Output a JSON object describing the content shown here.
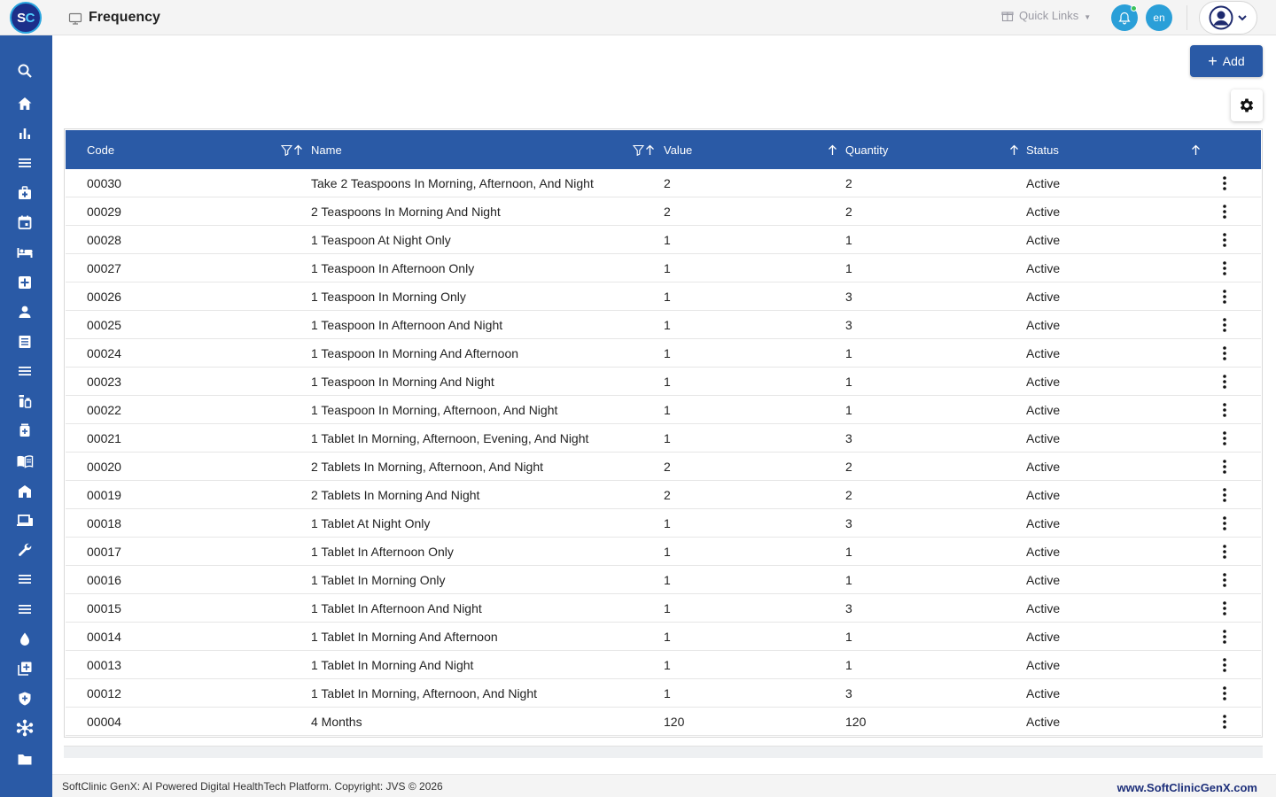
{
  "app": {
    "logo_text_s": "S",
    "logo_text_c": "C",
    "page_title": "Frequency",
    "quick_links_label": "Quick Links",
    "language": "en"
  },
  "sidebar": {
    "items": [
      {
        "icon": "search-icon"
      },
      {
        "icon": "home-icon"
      },
      {
        "icon": "bar-chart-icon"
      },
      {
        "icon": "menu-lines-icon"
      },
      {
        "icon": "medical-bag-icon"
      },
      {
        "icon": "calendar-icon"
      },
      {
        "icon": "bed-icon"
      },
      {
        "icon": "medical-cross-icon"
      },
      {
        "icon": "person-icon"
      },
      {
        "icon": "document-icon"
      },
      {
        "icon": "menu-lines-icon"
      },
      {
        "icon": "pharmacy-icon"
      },
      {
        "icon": "medicine-box-icon"
      },
      {
        "icon": "book-icon"
      },
      {
        "icon": "building-icon"
      },
      {
        "icon": "devices-icon"
      },
      {
        "icon": "wrench-icon"
      },
      {
        "icon": "menu-lines-icon"
      },
      {
        "icon": "menu-lines-icon"
      },
      {
        "icon": "drop-icon"
      },
      {
        "icon": "add-copy-icon"
      },
      {
        "icon": "shield-icon"
      },
      {
        "icon": "hub-icon"
      },
      {
        "icon": "folder-icon"
      }
    ]
  },
  "toolbar": {
    "add_label": "Add"
  },
  "table": {
    "columns": [
      "Code",
      "Name",
      "Value",
      "Quantity",
      "Status"
    ],
    "rows": [
      {
        "code": "00030",
        "name": "Take 2 Teaspoons In Morning, Afternoon, And Night",
        "value": "2",
        "quantity": "2",
        "status": "Active"
      },
      {
        "code": "00029",
        "name": "2 Teaspoons In Morning And Night",
        "value": "2",
        "quantity": "2",
        "status": "Active"
      },
      {
        "code": "00028",
        "name": "1 Teaspoon At Night Only",
        "value": "1",
        "quantity": "1",
        "status": "Active"
      },
      {
        "code": "00027",
        "name": "1 Teaspoon In Afternoon Only",
        "value": "1",
        "quantity": "1",
        "status": "Active"
      },
      {
        "code": "00026",
        "name": "1 Teaspoon In Morning Only",
        "value": "1",
        "quantity": "3",
        "status": "Active"
      },
      {
        "code": "00025",
        "name": "1 Teaspoon In Afternoon And Night",
        "value": "1",
        "quantity": "3",
        "status": "Active"
      },
      {
        "code": "00024",
        "name": "1 Teaspoon In Morning And Afternoon",
        "value": "1",
        "quantity": "1",
        "status": "Active"
      },
      {
        "code": "00023",
        "name": "1 Teaspoon In Morning And Night",
        "value": "1",
        "quantity": "1",
        "status": "Active"
      },
      {
        "code": "00022",
        "name": "1 Teaspoon In Morning, Afternoon, And Night",
        "value": "1",
        "quantity": "1",
        "status": "Active"
      },
      {
        "code": "00021",
        "name": "1 Tablet In Morning, Afternoon, Evening, And Night",
        "value": "1",
        "quantity": "3",
        "status": "Active"
      },
      {
        "code": "00020",
        "name": "2 Tablets In Morning, Afternoon, And Night",
        "value": "2",
        "quantity": "2",
        "status": "Active"
      },
      {
        "code": "00019",
        "name": "2 Tablets In Morning And Night",
        "value": "2",
        "quantity": "2",
        "status": "Active"
      },
      {
        "code": "00018",
        "name": "1 Tablet At Night Only",
        "value": "1",
        "quantity": "3",
        "status": "Active"
      },
      {
        "code": "00017",
        "name": "1 Tablet In Afternoon Only",
        "value": "1",
        "quantity": "1",
        "status": "Active"
      },
      {
        "code": "00016",
        "name": "1 Tablet In Morning Only",
        "value": "1",
        "quantity": "1",
        "status": "Active"
      },
      {
        "code": "00015",
        "name": "1 Tablet In Afternoon And Night",
        "value": "1",
        "quantity": "3",
        "status": "Active"
      },
      {
        "code": "00014",
        "name": "1 Tablet In Morning And Afternoon",
        "value": "1",
        "quantity": "1",
        "status": "Active"
      },
      {
        "code": "00013",
        "name": "1 Tablet In Morning And Night",
        "value": "1",
        "quantity": "1",
        "status": "Active"
      },
      {
        "code": "00012",
        "name": "1 Tablet In Morning, Afternoon, And Night",
        "value": "1",
        "quantity": "3",
        "status": "Active"
      },
      {
        "code": "00004",
        "name": "4 Months",
        "value": "120",
        "quantity": "120",
        "status": "Active"
      }
    ]
  },
  "footer": {
    "copyright": "SoftClinic GenX: AI Powered Digital HealthTech Platform. Copyright: JVS © 2026",
    "website": "www.SoftClinicGenX.com"
  },
  "colors": {
    "primary": "#2a5aa6",
    "accent": "#2a9fd8",
    "notification_dot": "#3bc35c",
    "footer_link": "#1d2f7a"
  }
}
